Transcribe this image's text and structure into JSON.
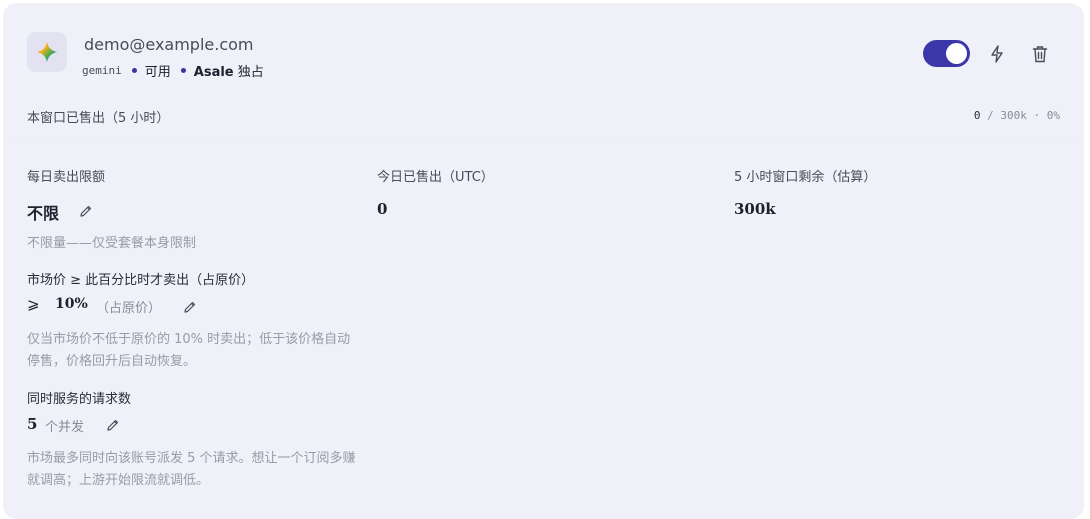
{
  "account": {
    "email": "demo@example.com",
    "provider": "gemini",
    "status": "可用",
    "owner_name": "Asale",
    "owner_suffix": " 独占",
    "enabled": true
  },
  "window": {
    "label": "本窗口已售出（5 小时）",
    "sold": "0",
    "separator": " / ",
    "capacity": "300k",
    "dot": " · ",
    "percent": "0%"
  },
  "columns": {
    "daily_limit": {
      "label": "每日卖出限额",
      "value": "不限",
      "hint": "不限量——仅受套餐本身限制"
    },
    "today_sold": {
      "label": "今日已售出（UTC）",
      "value": "0"
    },
    "window_remaining": {
      "label": "5 小时窗口剩余（估算）",
      "value": "300k"
    }
  },
  "price_floor": {
    "label": "市场价 ≥ 此百分比时才卖出（占原价）",
    "symbol": "⩾",
    "value": "10%",
    "unit": "（占原价）",
    "hint": "仅当市场价不低于原价的 10% 时卖出；低于该价格自动停售，价格回升后自动恢复。"
  },
  "concurrency": {
    "label": "同时服务的请求数",
    "value": "5",
    "unit": "个并发",
    "hint": "市场最多同时向该账号派发 5 个请求。想让一个订阅多赚就调高；上游开始限流就调低。"
  },
  "colors": {
    "accent": "#3b37a8",
    "card_bg": "#f0f0f8",
    "muted": "#9a9aa8"
  },
  "icons": {
    "logo": "gemini-sparkle-icon",
    "lightning": "lightning-icon",
    "trash": "trash-icon",
    "edit": "pencil-icon"
  }
}
